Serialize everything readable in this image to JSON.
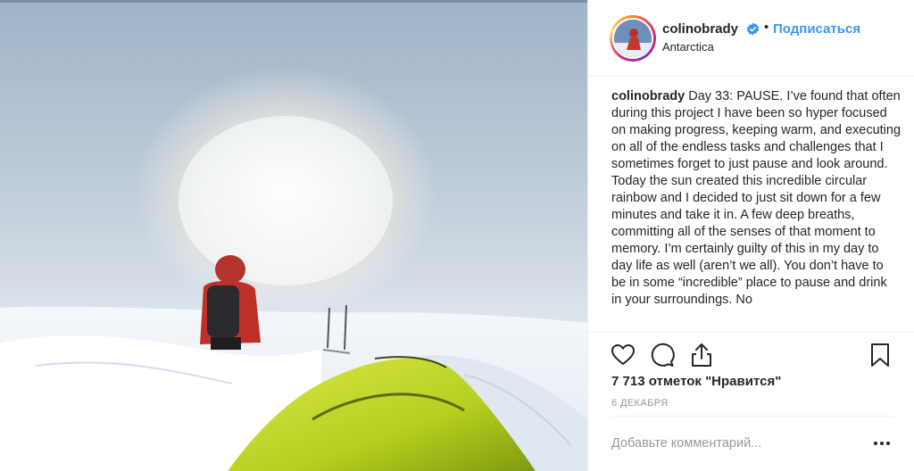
{
  "post": {
    "author": {
      "username": "colinobrady",
      "verified": true,
      "follow_label": "Подписаться",
      "separator": "•",
      "location": "Antarctica"
    },
    "caption": {
      "username": "colinobrady",
      "text": "Day 33: PAUSE. I’ve found that often during this project I have been so hyper focused on making progress, keeping warm, and executing on all of the endless tasks and challenges that I sometimes forget to just pause and look around. Today the sun created this incredible circular rainbow and I decided to just sit down for a few minutes and take it in. A few deep breaths, committing all of the senses of that moment to memory. I’m certainly guilty of this in my day to day life as well (aren’t we all). You don’t have to be in some “incredible” place to pause and drink in your surroundings. No"
    },
    "actions": {
      "like": "heart-icon",
      "comment": "comment-bubble-icon",
      "share": "share-icon",
      "save": "bookmark-icon"
    },
    "likes_text": "7 713 отметок \"Нравится\"",
    "date_text": "6 ДЕКАБРЯ",
    "comment": {
      "placeholder": "Добавьте комментарий...",
      "value": "",
      "more_icon": "more-horizontal-icon"
    },
    "colors": {
      "link": "#3897f0",
      "text": "#262626",
      "muted": "#999999",
      "divider": "#efefef"
    }
  }
}
